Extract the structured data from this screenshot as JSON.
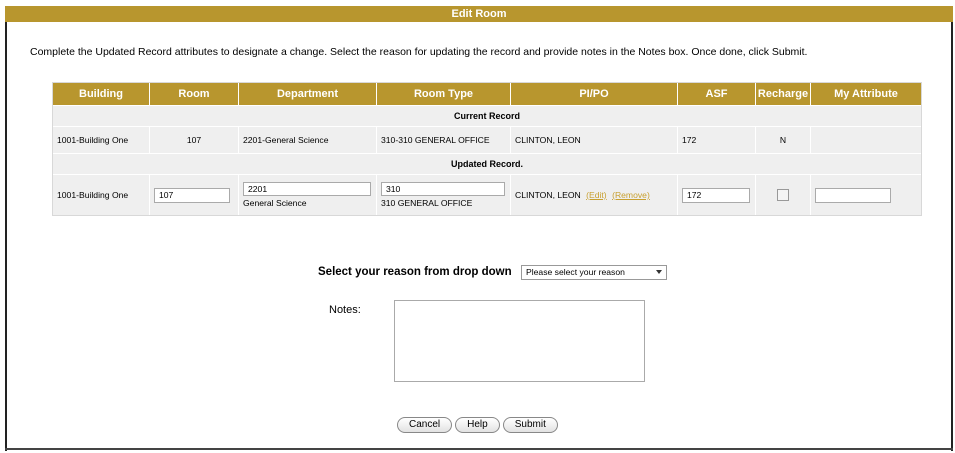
{
  "window": {
    "title": "Edit Room"
  },
  "instructions": "Complete the Updated Record attributes to designate a change. Select the reason for updating the record and provide notes in the Notes box. Once done, click Submit.",
  "table": {
    "headers": [
      "Building",
      "Room",
      "Department",
      "Room Type",
      "PI/PO",
      "ASF",
      "Recharge",
      "My Attribute"
    ],
    "current_section": "Current Record",
    "current": {
      "building": "1001-Building One",
      "room": "107",
      "department": "2201-General Science",
      "room_type": "310-310 GENERAL OFFICE",
      "pipo": "CLINTON, LEON",
      "asf": "172",
      "recharge": "N",
      "my_attribute": ""
    },
    "updated_section": "Updated Record.",
    "updated": {
      "building": "1001-Building One",
      "room": "107",
      "department_code": "2201",
      "department_name": "General Science",
      "room_type_code": "310",
      "room_type_name": "310 GENERAL OFFICE",
      "pipo": "CLINTON, LEON",
      "edit_link": "(Edit)",
      "remove_link": "(Remove)",
      "asf": "172",
      "recharge_checked": false,
      "my_attribute": ""
    }
  },
  "reason": {
    "label": "Select your reason from drop down",
    "selected": "Please select your reason"
  },
  "notes": {
    "label": "Notes:",
    "value": ""
  },
  "buttons": {
    "cancel": "Cancel",
    "help": "Help",
    "submit": "Submit"
  },
  "colors": {
    "header_gold": "#b8962e",
    "link_gold": "#c8a030",
    "grid_bg": "#efefef"
  }
}
